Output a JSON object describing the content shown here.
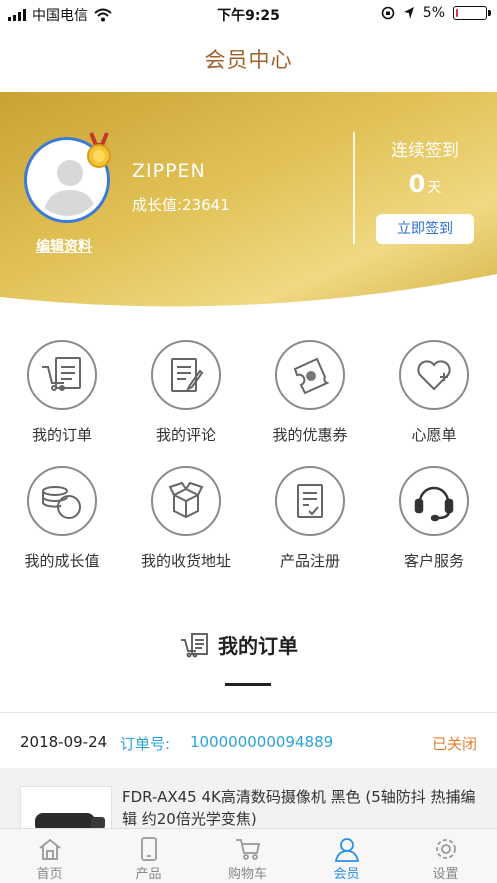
{
  "status_bar": {
    "carrier": "中国电信",
    "time": "下午9:25",
    "battery": "5%",
    "battery_level": 0.05
  },
  "navbar": {
    "title": "会员中心"
  },
  "profile": {
    "username": "ZIPPEN",
    "growth": "成长值:23641",
    "edit_label": "编辑资料",
    "sign_title": "连续签到",
    "sign_days": "0",
    "sign_unit": "天",
    "sign_button": "立即签到"
  },
  "grid": [
    {
      "label": "我的订单",
      "icon": "cart-list-icon"
    },
    {
      "label": "我的评论",
      "icon": "comment-edit-icon"
    },
    {
      "label": "我的优惠券",
      "icon": "coupon-icon"
    },
    {
      "label": "心愿单",
      "icon": "heart-icon"
    },
    {
      "label": "我的成长值",
      "icon": "coins-icon"
    },
    {
      "label": "我的收货地址",
      "icon": "package-icon"
    },
    {
      "label": "产品注册",
      "icon": "register-doc-icon"
    },
    {
      "label": "客户服务",
      "icon": "headset-icon"
    }
  ],
  "orders": {
    "section_title": "我的订单",
    "date": "2018-09-24",
    "order_no_label": "订单号:",
    "order_no": "100000000094889",
    "status": "已关闭",
    "product_name": "FDR-AX45 4K高清数码摄像机 黑色 (5轴防抖 热捕编辑 约20倍光学变焦)"
  },
  "tabbar": [
    {
      "label": "首页",
      "icon": "home-icon"
    },
    {
      "label": "产品",
      "icon": "phone-icon"
    },
    {
      "label": "购物车",
      "icon": "cart-icon"
    },
    {
      "label": "会员",
      "icon": "user-icon"
    },
    {
      "label": "设置",
      "icon": "settings-icon"
    }
  ],
  "colors": {
    "title_brown": "#a0622a",
    "gold": "#d9b13e",
    "link_blue": "#2aa3d8",
    "status_orange": "#e0802f",
    "tab_active": "#2b8fe6"
  }
}
